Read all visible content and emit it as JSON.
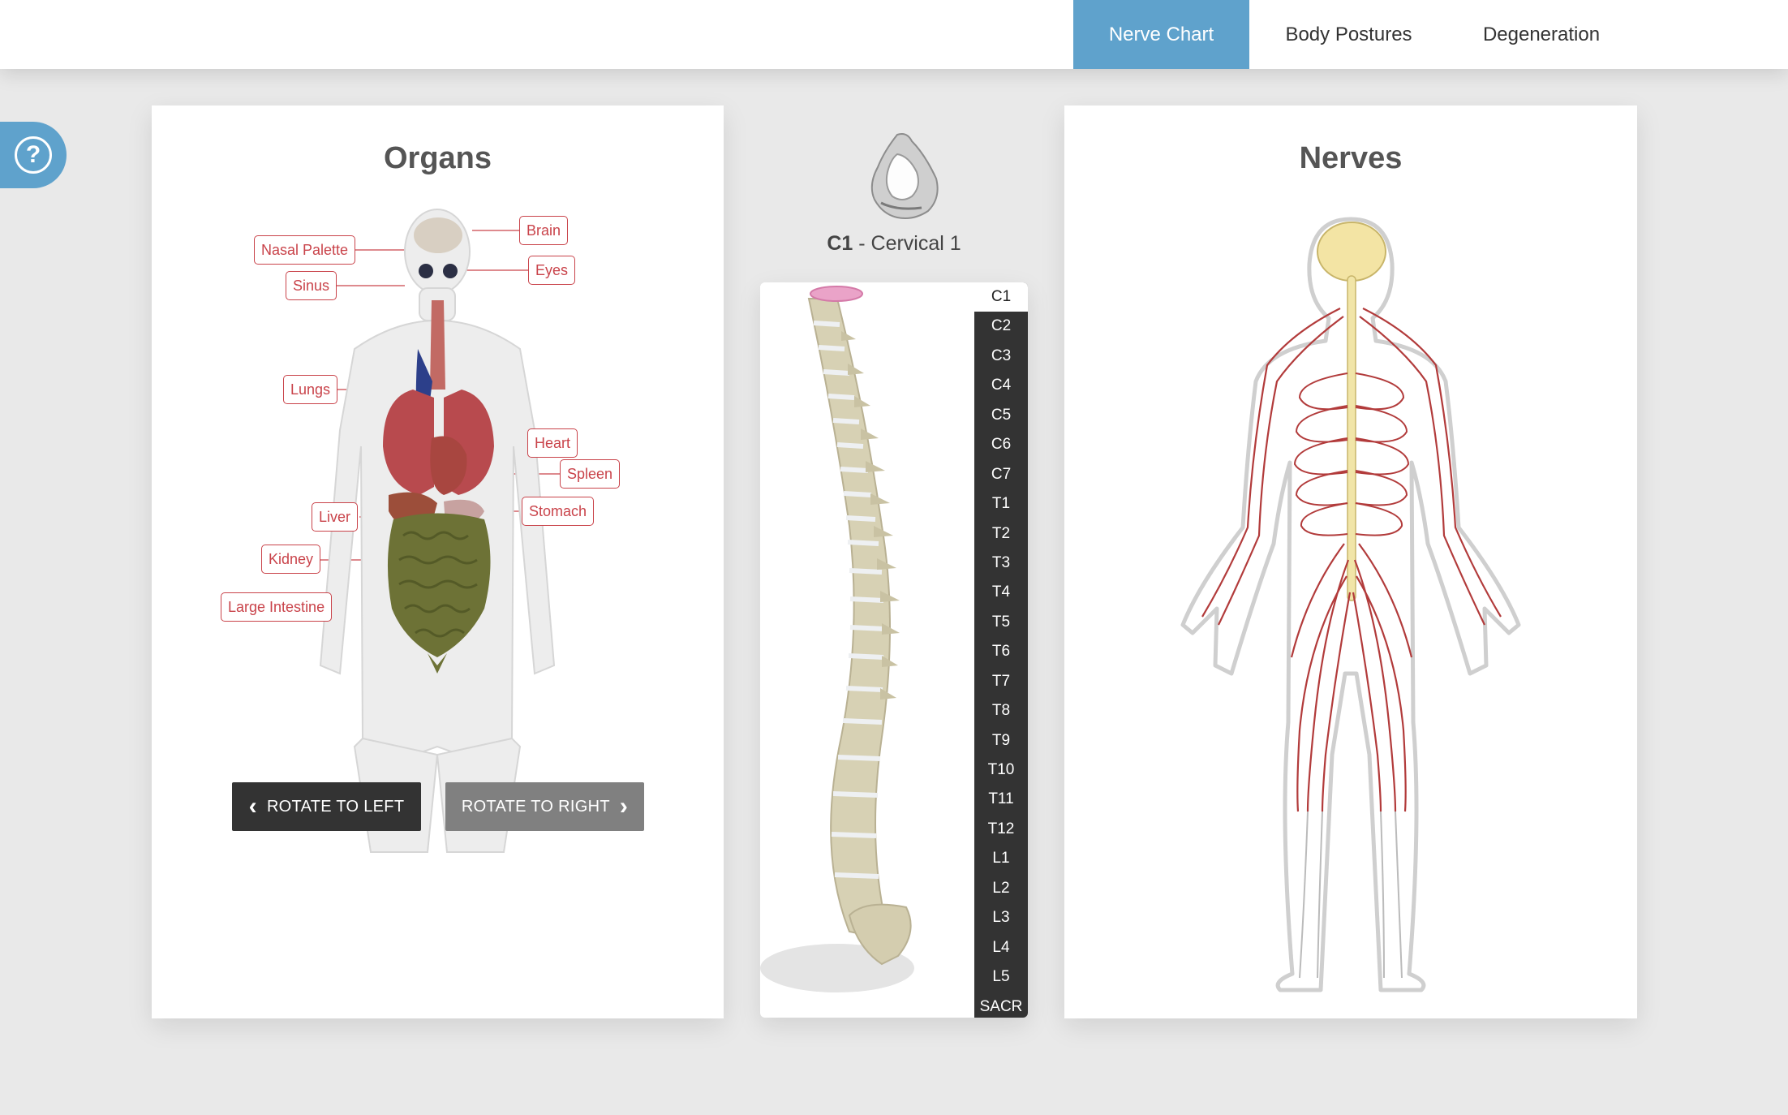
{
  "nav": {
    "tabs": [
      {
        "label": "Nerve Chart",
        "active": true
      },
      {
        "label": "Body Postures",
        "active": false
      },
      {
        "label": "Degeneration",
        "active": false
      }
    ]
  },
  "help": {
    "icon": "question-circle-icon",
    "glyph": "?"
  },
  "organs": {
    "title": "Organs",
    "labels": [
      "Nasal Palette",
      "Sinus",
      "Lungs",
      "Liver",
      "Kidney",
      "Large Intestine",
      "Brain",
      "Eyes",
      "Heart",
      "Spleen",
      "Stomach"
    ],
    "rotate_left": "ROTATE TO LEFT",
    "rotate_right": "ROTATE TO RIGHT"
  },
  "spine": {
    "selected_code": "C1",
    "selected_name": "- Cervical 1",
    "vertebrae": [
      "C1",
      "C2",
      "C3",
      "C4",
      "C5",
      "C6",
      "C7",
      "T1",
      "T2",
      "T3",
      "T4",
      "T5",
      "T6",
      "T7",
      "T8",
      "T9",
      "T10",
      "T11",
      "T12",
      "L1",
      "L2",
      "L3",
      "L4",
      "L5",
      "SACR"
    ]
  },
  "nerves": {
    "title": "Nerves"
  },
  "colors": {
    "accent": "#5fa2cc",
    "label_red": "#c9434a",
    "nerve_red": "#b23b3b",
    "dark_button": "#333333",
    "grey_button": "#808080",
    "page_bg": "#e9e9e9"
  }
}
